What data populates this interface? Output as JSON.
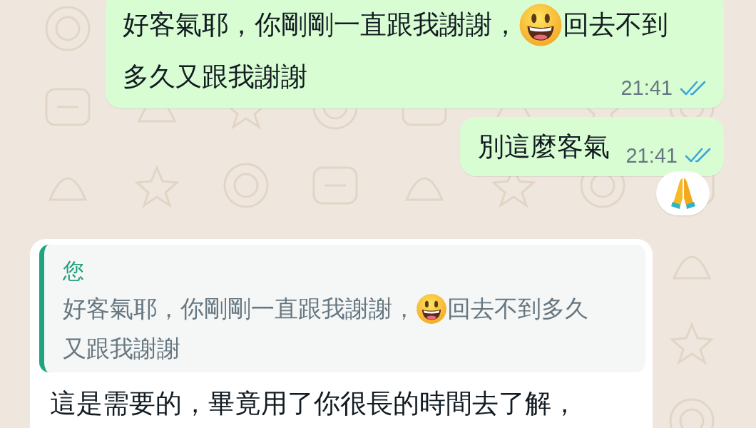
{
  "messages": [
    {
      "kind": "outgoing",
      "segments": [
        {
          "kind": "text",
          "text": "好客氣耶，你剛剛一直跟我謝謝，"
        },
        {
          "kind": "smiley"
        },
        {
          "kind": "text",
          "text": "回去不到"
        },
        {
          "kind": "text",
          "text": "多久又跟我謝謝"
        }
      ],
      "time": "21:41",
      "read": true,
      "reacted": false
    },
    {
      "kind": "outgoing",
      "segments": [
        {
          "kind": "text",
          "text": "別這麼客氣"
        }
      ],
      "time": "21:41",
      "read": true,
      "reacted": true
    },
    {
      "kind": "incoming",
      "quote": {
        "author": "您",
        "segments": [
          {
            "kind": "text",
            "text": "好客氣耶，你剛剛一直跟我謝謝，"
          },
          {
            "kind": "smiley"
          },
          {
            "kind": "text",
            "text": "回去不到多久"
          },
          {
            "kind": "text",
            "text": "又跟我謝謝"
          }
        ]
      },
      "segments": [
        {
          "kind": "text",
          "text": "這是需要的，畢竟用了你很長的時間去了解，"
        }
      ]
    }
  ]
}
